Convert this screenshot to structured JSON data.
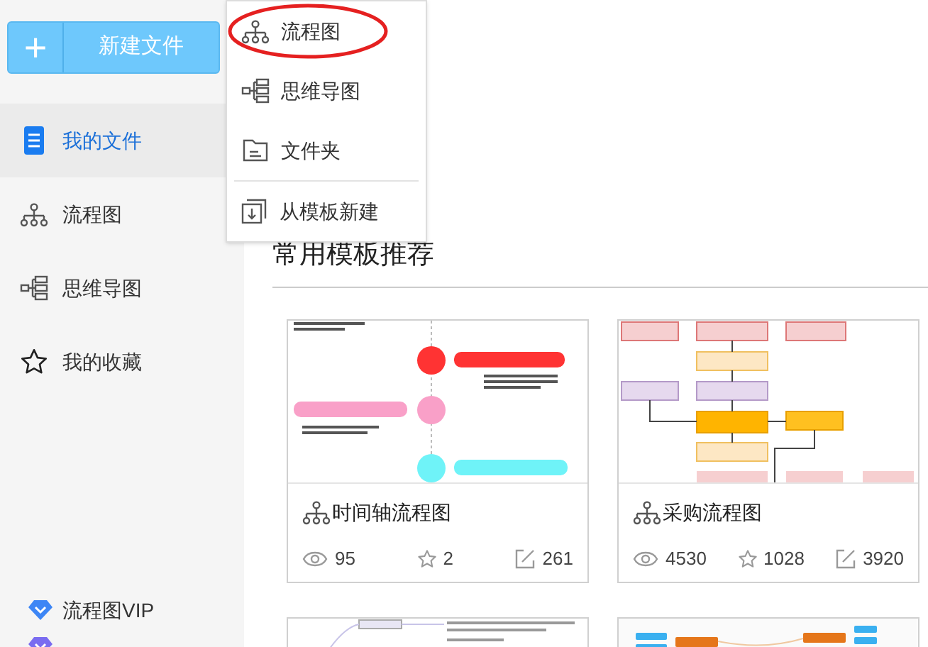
{
  "new_button": {
    "icon": "+",
    "label": "新建文件"
  },
  "sidebar": {
    "items": [
      {
        "kind": "file",
        "label": "我的文件",
        "selected": true
      },
      {
        "kind": "flowchart",
        "label": "流程图",
        "selected": false
      },
      {
        "kind": "mindmap",
        "label": "思维导图",
        "selected": false
      },
      {
        "kind": "star",
        "label": "我的收藏",
        "selected": false
      }
    ],
    "vip_items": [
      {
        "label": "流程图VIP",
        "color": "#3d86f5"
      },
      {
        "color": "#7a6cf0"
      }
    ]
  },
  "dropdown": {
    "groups": [
      [
        {
          "kind": "flowchart",
          "label": "流程图",
          "highlighted": true
        },
        {
          "kind": "mindmap",
          "label": "思维导图",
          "highlighted": false
        },
        {
          "kind": "folder",
          "label": "文件夹",
          "highlighted": false
        }
      ],
      [
        {
          "kind": "template",
          "label": "从模板新建",
          "highlighted": false
        }
      ]
    ]
  },
  "section": {
    "title": "常用模板推荐"
  },
  "cards": [
    {
      "kind": "timeline",
      "title": "时间轴流程图",
      "views": "95",
      "stars": "2",
      "edits": "261"
    },
    {
      "kind": "flowchart",
      "title": "采购流程图",
      "views": "4530",
      "stars": "1028",
      "edits": "3920"
    },
    {
      "kind": "mindmap"
    },
    {
      "kind": "mindmap_color"
    }
  ]
}
